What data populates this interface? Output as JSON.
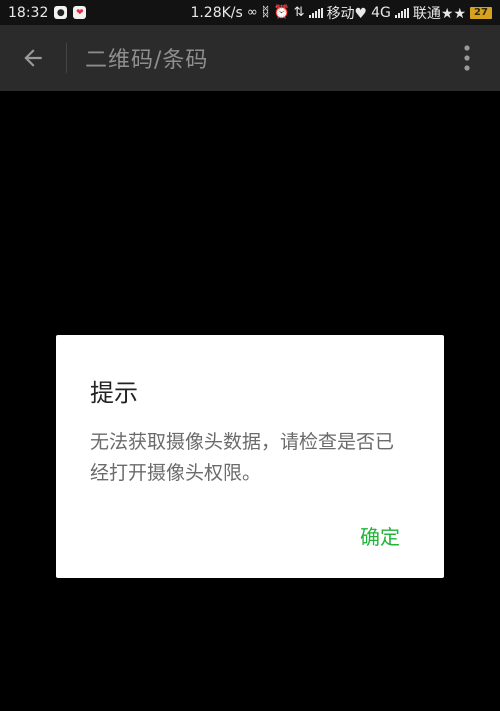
{
  "status_bar": {
    "time": "18:32",
    "net_speed": "1.28K/s",
    "carrier1": "移动♥",
    "network_type": "4G",
    "carrier2": "联通★★",
    "battery": "27",
    "app_icon_1": "qq-penguin-icon",
    "app_icon_2": "heart-app-icon",
    "link_icon": "link-icon",
    "bluetooth_icon": "bluetooth-icon",
    "alarm_icon": "alarm-icon",
    "data_icon": "data-transfer-icon"
  },
  "toolbar": {
    "title": "二维码/条码",
    "back_icon": "arrow-back-icon",
    "menu_icon": "more-vertical-icon"
  },
  "dialog": {
    "title": "提示",
    "message": "无法获取摄像头数据，请检查是否已经打开摄像头权限。",
    "ok_label": "确定",
    "accent_color": "#22b33a"
  }
}
